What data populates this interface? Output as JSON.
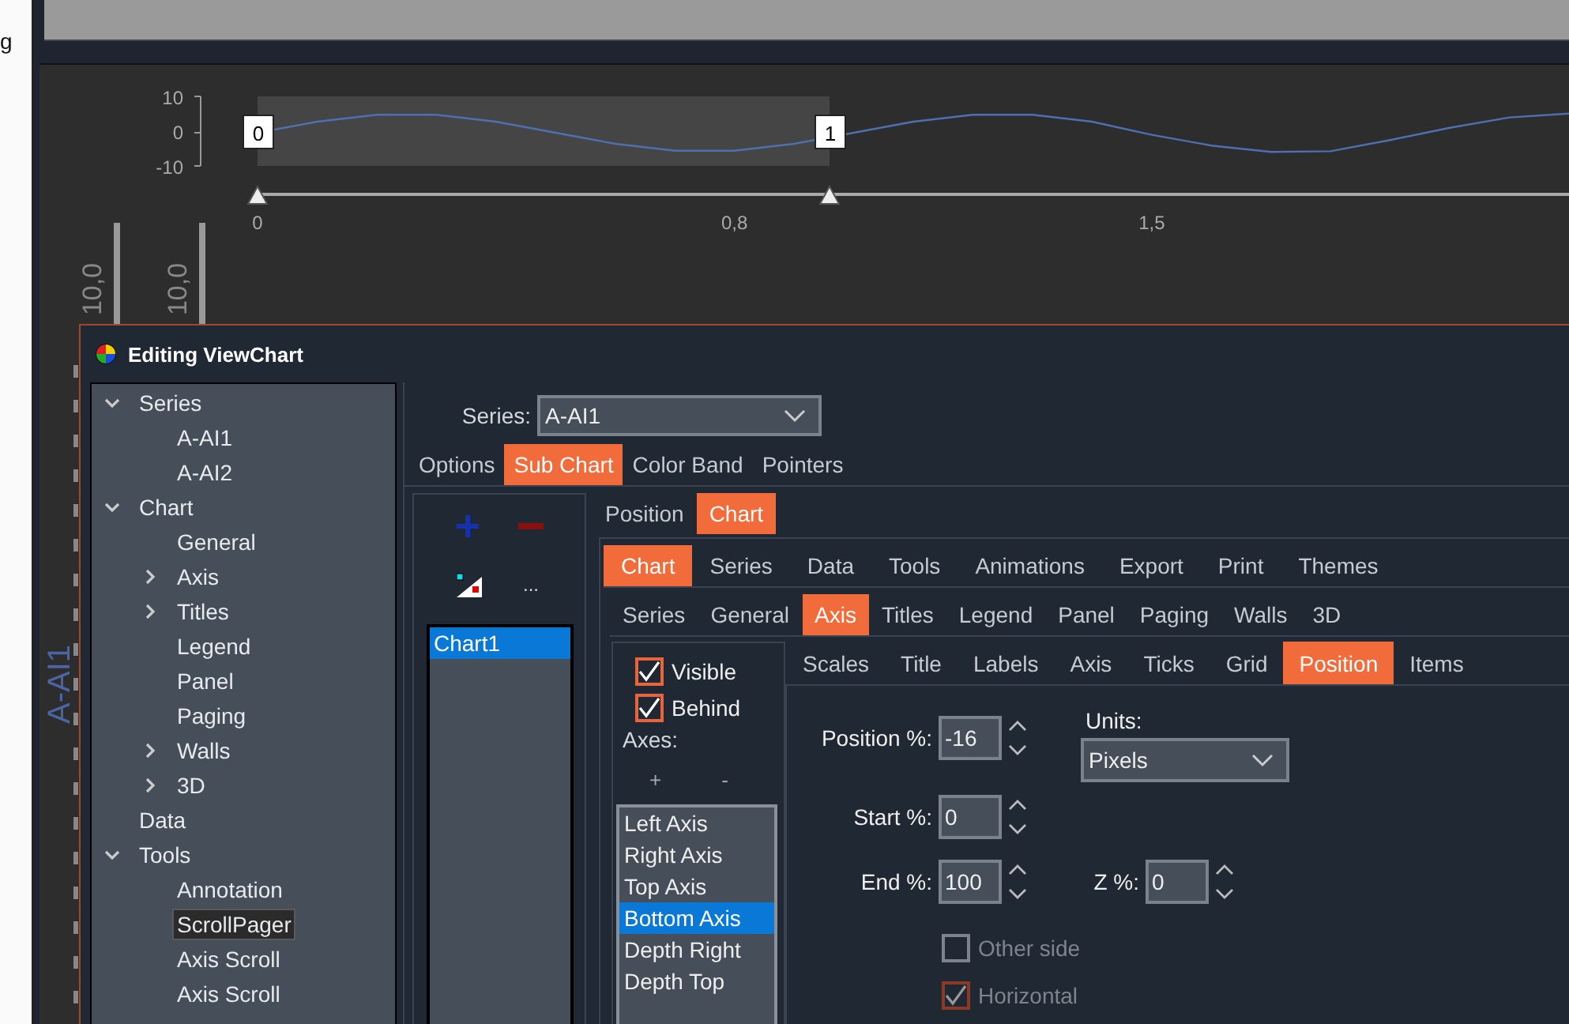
{
  "left_edge_text": "g",
  "scroll_pager": {
    "handles": [
      "0",
      "1"
    ],
    "chart_data": {
      "type": "line",
      "x": [
        0,
        0.1,
        0.2,
        0.3,
        0.4,
        0.5,
        0.6,
        0.7,
        0.8,
        0.9,
        1,
        1.1,
        1.2,
        1.3,
        1.4,
        1.5,
        1.6,
        1.7,
        1.8,
        1.9,
        2,
        2.1,
        2.2
      ],
      "series": [
        {
          "color": "#4e6fb0",
          "values": [
            0,
            3.2,
            5.2,
            5.2,
            3.2,
            0,
            -3.2,
            -5.2,
            -5.2,
            -3.2,
            0,
            3.2,
            5.2,
            5.2,
            3.2,
            -0.6,
            -3.7,
            -5.5,
            -5.3,
            -2.1,
            1.4,
            4.4,
            5.5
          ]
        }
      ],
      "xlim": [
        0,
        2.2
      ],
      "ylim": [
        -10,
        10
      ],
      "yticks": [
        10,
        0,
        -10
      ],
      "xticks": [
        {
          "value": 0,
          "label": "0"
        },
        {
          "value": 0.8,
          "label": "0,8"
        },
        {
          "value": 1.5,
          "label": "1,5"
        }
      ]
    }
  },
  "axis_labels": [
    "10,0",
    "10,0"
  ],
  "axis_title": "A-AI1",
  "dialog": {
    "title": "Editing ViewChart",
    "tree": [
      {
        "label": "Series",
        "expanded": true,
        "selected": false,
        "children": [
          {
            "label": "A-AI1",
            "selected": false
          },
          {
            "label": "A-AI2",
            "selected": false
          }
        ]
      },
      {
        "label": "Chart",
        "expanded": true,
        "selected": false,
        "children": [
          {
            "label": "General",
            "selected": false
          },
          {
            "label": "Axis",
            "expanded": false,
            "selected": false
          },
          {
            "label": "Titles",
            "expanded": false,
            "selected": false
          },
          {
            "label": "Legend",
            "selected": false
          },
          {
            "label": "Panel",
            "selected": false
          },
          {
            "label": "Paging",
            "selected": false
          },
          {
            "label": "Walls",
            "expanded": false,
            "selected": false
          },
          {
            "label": "3D",
            "expanded": false,
            "selected": false
          }
        ]
      },
      {
        "label": "Data",
        "selected": false
      },
      {
        "label": "Tools",
        "expanded": true,
        "selected": false,
        "children": [
          {
            "label": "Annotation",
            "selected": false
          },
          {
            "label": "ScrollPager",
            "selected": true
          },
          {
            "label": "Axis Scroll",
            "selected": false
          },
          {
            "label": "Axis Scroll",
            "selected": false
          }
        ]
      }
    ],
    "series_field": {
      "label": "Series:",
      "value": "A-AI1"
    },
    "tabs": [
      {
        "label": "Options",
        "selected": false
      },
      {
        "label": "Sub Chart",
        "selected": true
      },
      {
        "label": "Color Band",
        "selected": false
      },
      {
        "label": "Pointers",
        "selected": false
      }
    ],
    "subchart": {
      "more_button": "...",
      "charts": [
        {
          "label": "Chart1",
          "selected": true
        }
      ]
    },
    "subchart_tabs": [
      {
        "label": "Position",
        "selected": false
      },
      {
        "label": "Chart",
        "selected": true
      }
    ],
    "editor_tabs": [
      {
        "label": "Chart",
        "selected": true
      },
      {
        "label": "Series",
        "selected": false
      },
      {
        "label": "Data",
        "selected": false
      },
      {
        "label": "Tools",
        "selected": false
      },
      {
        "label": "Animations",
        "selected": false
      },
      {
        "label": "Export",
        "selected": false
      },
      {
        "label": "Print",
        "selected": false
      },
      {
        "label": "Themes",
        "selected": false
      }
    ],
    "chart_tabs": [
      {
        "label": "Series",
        "selected": false
      },
      {
        "label": "General",
        "selected": false
      },
      {
        "label": "Axis",
        "selected": true
      },
      {
        "label": "Titles",
        "selected": false
      },
      {
        "label": "Legend",
        "selected": false
      },
      {
        "label": "Panel",
        "selected": false
      },
      {
        "label": "Paging",
        "selected": false
      },
      {
        "label": "Walls",
        "selected": false
      },
      {
        "label": "3D",
        "selected": false
      }
    ],
    "axis_options": {
      "checkboxes": [
        {
          "label": "Visible",
          "checked": true
        },
        {
          "label": "Behind",
          "checked": true
        }
      ],
      "axes_label": "Axes:",
      "add_button": "+",
      "remove_button": "-",
      "axes": [
        {
          "label": "Left Axis",
          "selected": false
        },
        {
          "label": "Right Axis",
          "selected": false
        },
        {
          "label": "Top Axis",
          "selected": false
        },
        {
          "label": "Bottom Axis",
          "selected": true
        },
        {
          "label": "Depth Right",
          "selected": false
        },
        {
          "label": "Depth Top",
          "selected": false
        }
      ]
    },
    "axis_tabs": [
      {
        "label": "Scales",
        "selected": false
      },
      {
        "label": "Title",
        "selected": false
      },
      {
        "label": "Labels",
        "selected": false
      },
      {
        "label": "Axis",
        "selected": false
      },
      {
        "label": "Ticks",
        "selected": false
      },
      {
        "label": "Grid",
        "selected": false
      },
      {
        "label": "Position",
        "selected": true
      },
      {
        "label": "Items",
        "selected": false
      }
    ],
    "position": {
      "fields": [
        {
          "label": "Position %:",
          "value": "-16"
        },
        {
          "label": "Start %:",
          "value": "0"
        },
        {
          "label": "End %:",
          "value": "100"
        }
      ],
      "units": {
        "label": "Units:",
        "value": "Pixels"
      },
      "z_field": {
        "label": "Z %:",
        "value": "0"
      },
      "checkboxes": [
        {
          "label": "Other side",
          "checked": false,
          "disabled": true
        },
        {
          "label": "Horizontal",
          "checked": true,
          "disabled": true
        }
      ]
    }
  }
}
